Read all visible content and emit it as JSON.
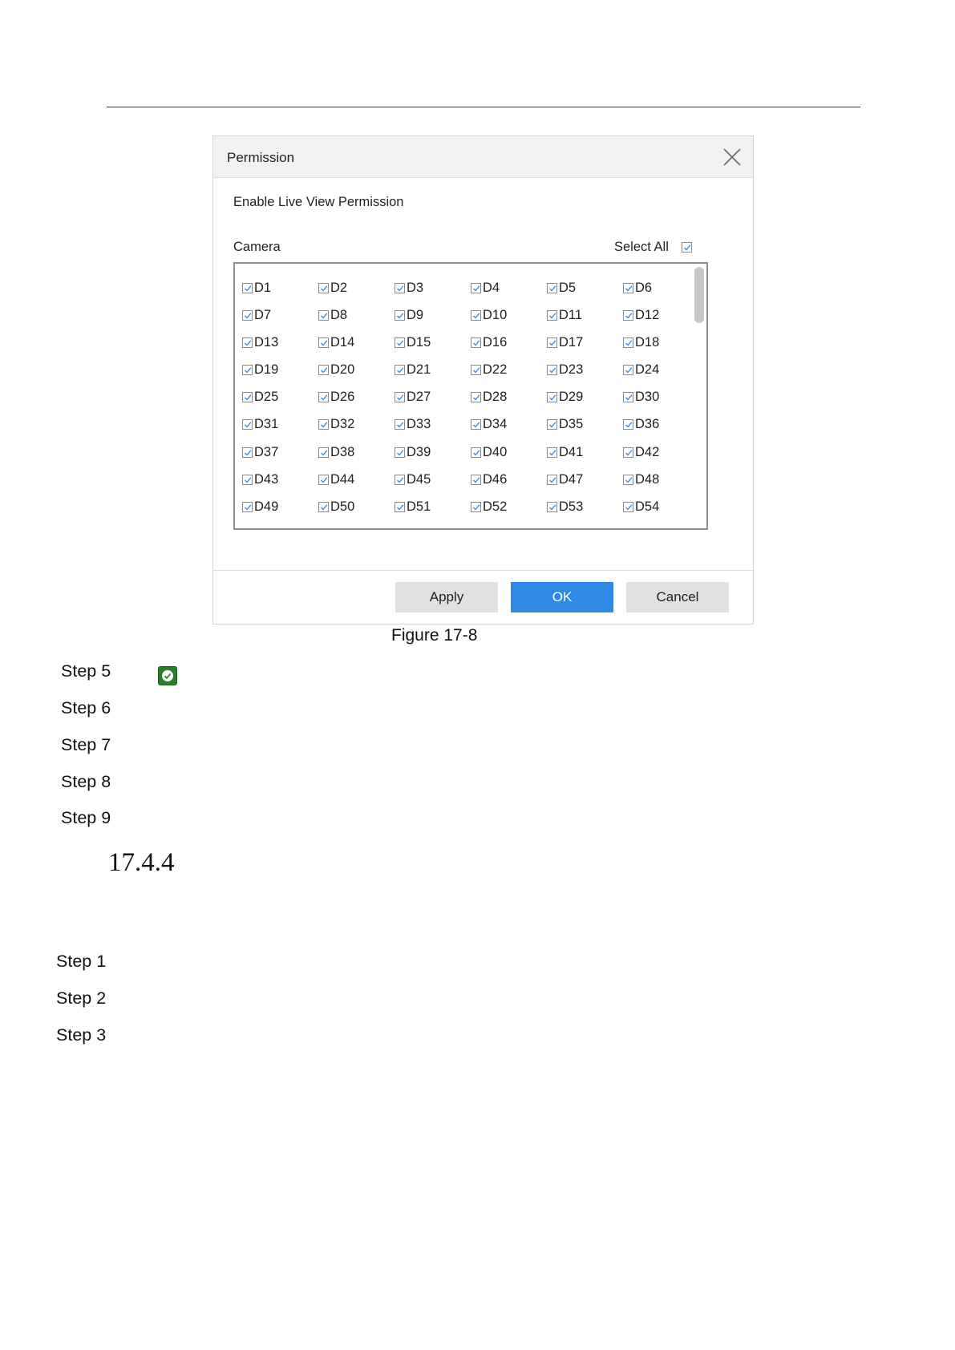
{
  "dialog": {
    "title": "Permission",
    "section_title": "Enable Live View Permission",
    "camera_label": "Camera",
    "select_all_label": "Select All",
    "select_all_checked": true,
    "cameras": [
      "D1",
      "D2",
      "D3",
      "D4",
      "D5",
      "D6",
      "D7",
      "D8",
      "D9",
      "D10",
      "D11",
      "D12",
      "D13",
      "D14",
      "D15",
      "D16",
      "D17",
      "D18",
      "D19",
      "D20",
      "D21",
      "D22",
      "D23",
      "D24",
      "D25",
      "D26",
      "D27",
      "D28",
      "D29",
      "D30",
      "D31",
      "D32",
      "D33",
      "D34",
      "D35",
      "D36",
      "D37",
      "D38",
      "D39",
      "D40",
      "D41",
      "D42",
      "D43",
      "D44",
      "D45",
      "D46",
      "D47",
      "D48",
      "D49",
      "D50",
      "D51",
      "D52",
      "D53",
      "D54"
    ],
    "all_cameras_checked": true,
    "buttons": {
      "apply": "Apply",
      "ok": "OK",
      "cancel": "Cancel"
    },
    "colors": {
      "ok_button": "#2f8ae6",
      "secondary_button": "#e1e1e1",
      "titlebar": "#f1f1f1"
    }
  },
  "caption": "Figure 17-8",
  "steps_a": [
    "Step 5",
    "Step 6",
    "Step 7",
    "Step 8",
    "Step 9"
  ],
  "step5_icon": "green-check-icon",
  "section_number": "17.4.4",
  "steps_b": [
    "Step 1",
    "Step 2",
    "Step 3"
  ]
}
